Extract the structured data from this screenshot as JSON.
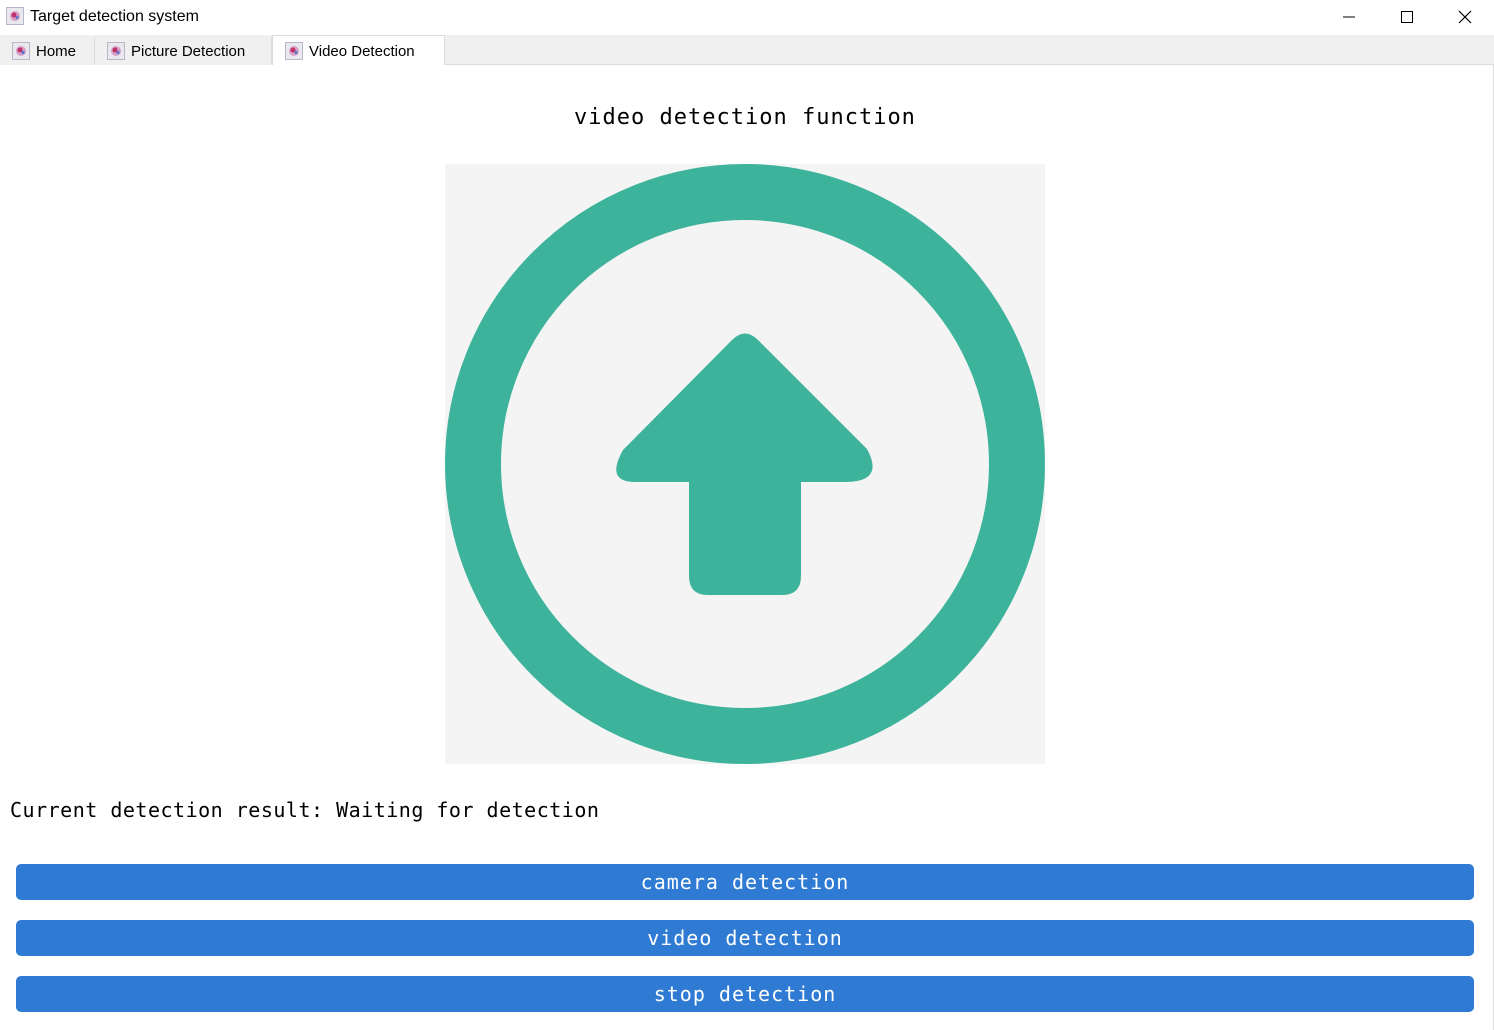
{
  "window": {
    "title": "Target detection system",
    "app_icon": "app-logo-icon",
    "controls": {
      "minimize_icon": "minimize-icon",
      "maximize_icon": "maximize-icon",
      "close_icon": "close-icon"
    }
  },
  "tabs": [
    {
      "label": "Home",
      "icon": "app-logo-icon",
      "active": false
    },
    {
      "label": "Picture Detection",
      "icon": "app-logo-icon",
      "active": false
    },
    {
      "label": "Video Detection",
      "icon": "app-logo-icon",
      "active": true
    }
  ],
  "main": {
    "title": "video detection function",
    "preview": {
      "icon": "upload-arrow-icon",
      "background_color": "#f4f4f4",
      "icon_color": "#3eb39c"
    },
    "result_text": "Current detection result: Waiting for detection",
    "buttons": {
      "camera": "camera detection",
      "video": "video detection",
      "stop": "stop detection"
    },
    "button_color": "#2f7bd3"
  }
}
